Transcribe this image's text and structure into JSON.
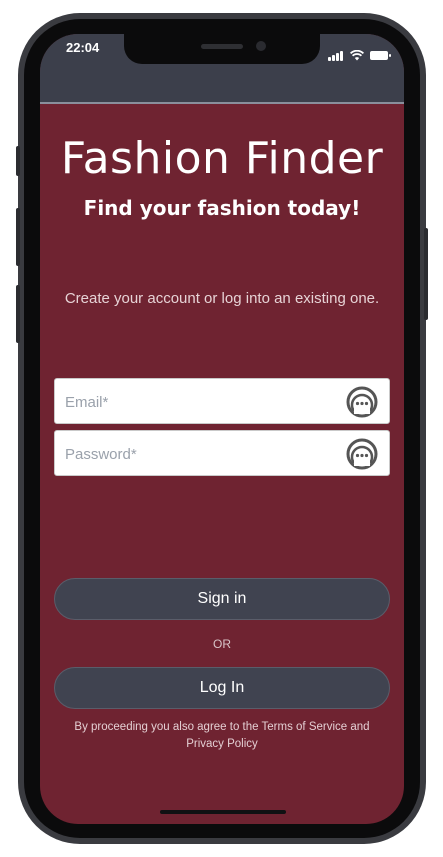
{
  "status_bar": {
    "time": "22:04"
  },
  "app": {
    "title": "Fashion Finder",
    "subtitle": "Find your fashion today!",
    "intro": "Create your account or log into an existing one."
  },
  "form": {
    "email_placeholder": "Email*",
    "password_placeholder": "Password*"
  },
  "actions": {
    "sign_in_label": "Sign in",
    "or_label": "OR",
    "log_in_label": "Log In"
  },
  "legal": {
    "terms_text": "By proceeding you also agree to the Terms of Service and Privacy Policy"
  },
  "colors": {
    "background": "#6f2331",
    "header": "#3c3f4b",
    "button": "#404350"
  },
  "icons": {
    "field_icon": "password-manager-key-icon"
  }
}
